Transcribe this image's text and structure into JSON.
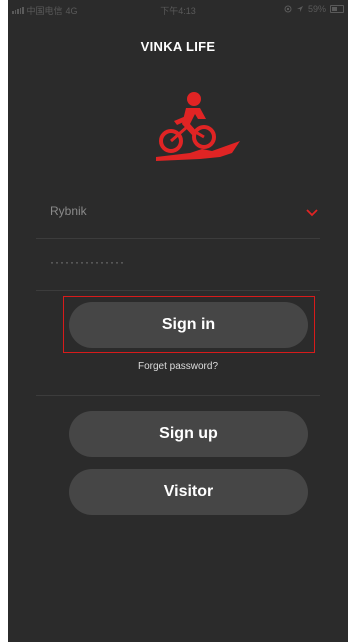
{
  "status_bar": {
    "carrier": "中国电信",
    "network": "4G",
    "time": "下午4:13",
    "battery": "59%"
  },
  "header": {
    "title": "VINKA LIFE"
  },
  "logo": {
    "icon": "cyclist-logo-icon",
    "color": "#e02424"
  },
  "form": {
    "city_value": "Rybnik",
    "password_masked": "···············"
  },
  "buttons": {
    "sign_in": "Sign in",
    "forget_password": "Forget password?",
    "sign_up": "Sign up",
    "visitor": "Visitor"
  },
  "colors": {
    "background": "#2b2b2b",
    "button": "#464646",
    "accent": "#e02424",
    "highlight": "#d81b1b"
  }
}
